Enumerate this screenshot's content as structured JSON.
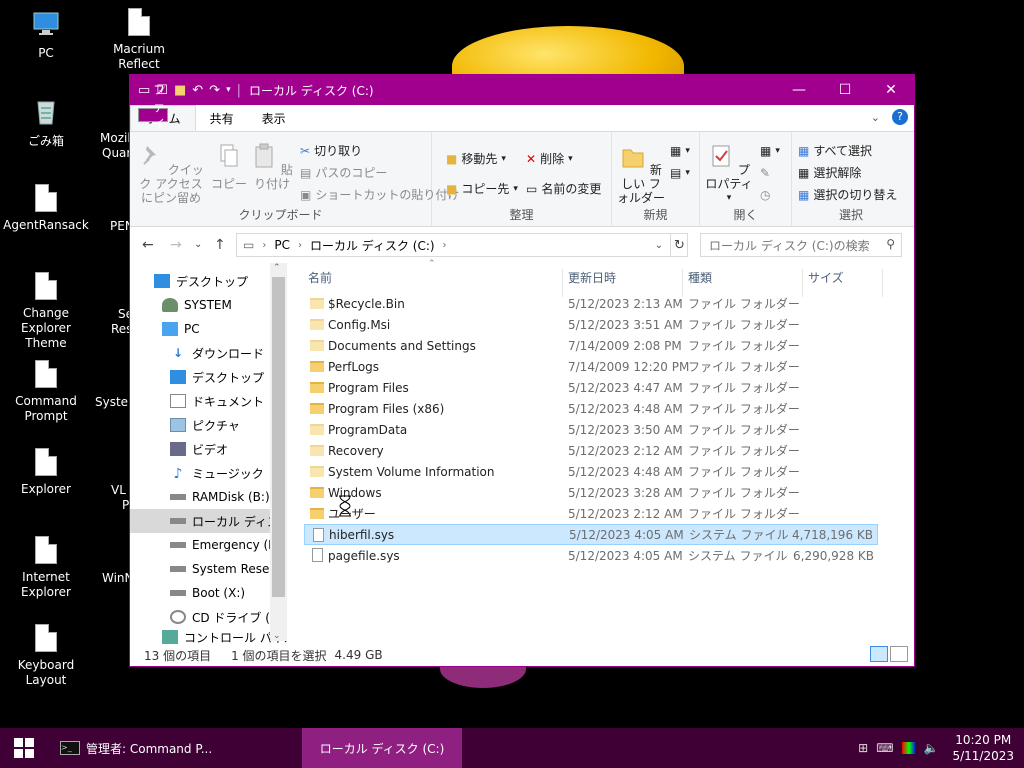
{
  "desktop": {
    "icons": [
      {
        "label": "PC"
      },
      {
        "label": "Macrium Reflect"
      },
      {
        "label": "ごみ箱"
      },
      {
        "label": "Mozil"
      },
      {
        "label": "Quar"
      },
      {
        "label": "AgentRansack"
      },
      {
        "label": "PEN"
      },
      {
        "label": "Change Explorer Theme"
      },
      {
        "label": "Se"
      },
      {
        "label": "Res"
      },
      {
        "label": "Command Prompt"
      },
      {
        "label": "System"
      },
      {
        "label": "Explorer"
      },
      {
        "label": "VL"
      },
      {
        "label": "P"
      },
      {
        "label": "Internet Explorer"
      },
      {
        "label": "WinN"
      },
      {
        "label": "Keyboard Layout"
      }
    ]
  },
  "window": {
    "title": "ローカル ディスク (C:)",
    "accent": "#a1008f",
    "tabs": [
      "ファイル",
      "ホーム",
      "共有",
      "表示"
    ],
    "ribbon": {
      "clipboard": {
        "pin_quick_access": "クイック アクセスにピン留め",
        "copy": "コピー",
        "paste": "貼り付け",
        "cut": "切り取り",
        "copy_path": "パスのコピー",
        "paste_shortcut": "ショートカットの貼り付け",
        "label": "クリップボード"
      },
      "organize": {
        "move_to": "移動先",
        "copy_to": "コピー先",
        "delete": "削除",
        "rename": "名前の変更",
        "label": "整理"
      },
      "new": {
        "new_folder": "新しい フォルダー",
        "label": "新規"
      },
      "open": {
        "properties": "プロパティ",
        "label": "開く"
      },
      "select": {
        "select_all": "すべて選択",
        "select_none": "選択解除",
        "invert": "選択の切り替え",
        "label": "選択"
      }
    },
    "address": {
      "crumbs": [
        "PC",
        "ローカル ディスク (C:)"
      ],
      "search_placeholder": "ローカル ディスク (C:)の検索"
    },
    "nav": [
      {
        "label": "デスクトップ",
        "icon": "desktop-icon"
      },
      {
        "label": "SYSTEM",
        "icon": "user-icon"
      },
      {
        "label": "PC",
        "icon": "pc-icon"
      },
      {
        "label": "ダウンロード",
        "icon": "download-icon"
      },
      {
        "label": "デスクトップ",
        "icon": "desktop-icon"
      },
      {
        "label": "ドキュメント",
        "icon": "documents-icon"
      },
      {
        "label": "ピクチャ",
        "icon": "pictures-icon"
      },
      {
        "label": "ビデオ",
        "icon": "video-icon"
      },
      {
        "label": "ミュージック",
        "icon": "music-icon"
      },
      {
        "label": "RAMDisk (B:)",
        "icon": "drive-icon"
      },
      {
        "label": "ローカル ディスク (",
        "icon": "drive-icon"
      },
      {
        "label": "Emergency (D:)",
        "icon": "drive-icon"
      },
      {
        "label": "System Reserve",
        "icon": "drive-icon"
      },
      {
        "label": "Boot (X:)",
        "icon": "drive-icon"
      },
      {
        "label": "CD ドライブ (Y:) V",
        "icon": "cd-icon"
      },
      {
        "label": "コントロール パネル",
        "icon": "control-panel-icon"
      }
    ],
    "columns": {
      "name": "名前",
      "date": "更新日時",
      "type": "種類",
      "size": "サイズ"
    },
    "files": [
      {
        "name": "$Recycle.Bin",
        "date": "5/12/2023 2:13 AM",
        "type": "ファイル フォルダー",
        "size": "",
        "kind": "folder-dim"
      },
      {
        "name": "Config.Msi",
        "date": "5/12/2023 3:51 AM",
        "type": "ファイル フォルダー",
        "size": "",
        "kind": "folder-dim"
      },
      {
        "name": "Documents and Settings",
        "date": "7/14/2009 2:08 PM",
        "type": "ファイル フォルダー",
        "size": "",
        "kind": "folder-dim"
      },
      {
        "name": "PerfLogs",
        "date": "7/14/2009 12:20 PM",
        "type": "ファイル フォルダー",
        "size": "",
        "kind": "folder"
      },
      {
        "name": "Program Files",
        "date": "5/12/2023 4:47 AM",
        "type": "ファイル フォルダー",
        "size": "",
        "kind": "folder"
      },
      {
        "name": "Program Files (x86)",
        "date": "5/12/2023 4:48 AM",
        "type": "ファイル フォルダー",
        "size": "",
        "kind": "folder"
      },
      {
        "name": "ProgramData",
        "date": "5/12/2023 3:50 AM",
        "type": "ファイル フォルダー",
        "size": "",
        "kind": "folder-dim"
      },
      {
        "name": "Recovery",
        "date": "5/12/2023 2:12 AM",
        "type": "ファイル フォルダー",
        "size": "",
        "kind": "folder-dim"
      },
      {
        "name": "System Volume Information",
        "date": "5/12/2023 4:48 AM",
        "type": "ファイル フォルダー",
        "size": "",
        "kind": "folder-dim"
      },
      {
        "name": "Windows",
        "date": "5/12/2023 3:28 AM",
        "type": "ファイル フォルダー",
        "size": "",
        "kind": "folder"
      },
      {
        "name": "ユーザー",
        "date": "5/12/2023 2:12 AM",
        "type": "ファイル フォルダー",
        "size": "",
        "kind": "folder"
      },
      {
        "name": "hiberfil.sys",
        "date": "5/12/2023 4:05 AM",
        "type": "システム ファイル",
        "size": "4,718,196 KB",
        "kind": "file",
        "selected": true
      },
      {
        "name": "pagefile.sys",
        "date": "5/12/2023 4:05 AM",
        "type": "システム ファイル",
        "size": "6,290,928 KB",
        "kind": "file"
      }
    ],
    "status": {
      "count": "13 個の項目",
      "selected": "1 個の項目を選択",
      "size": "4.49 GB"
    }
  },
  "taskbar": {
    "cmd": "管理者: Command P...",
    "explorer": "ローカル ディスク (C:)",
    "time": "10:20 PM",
    "date": "5/11/2023"
  }
}
